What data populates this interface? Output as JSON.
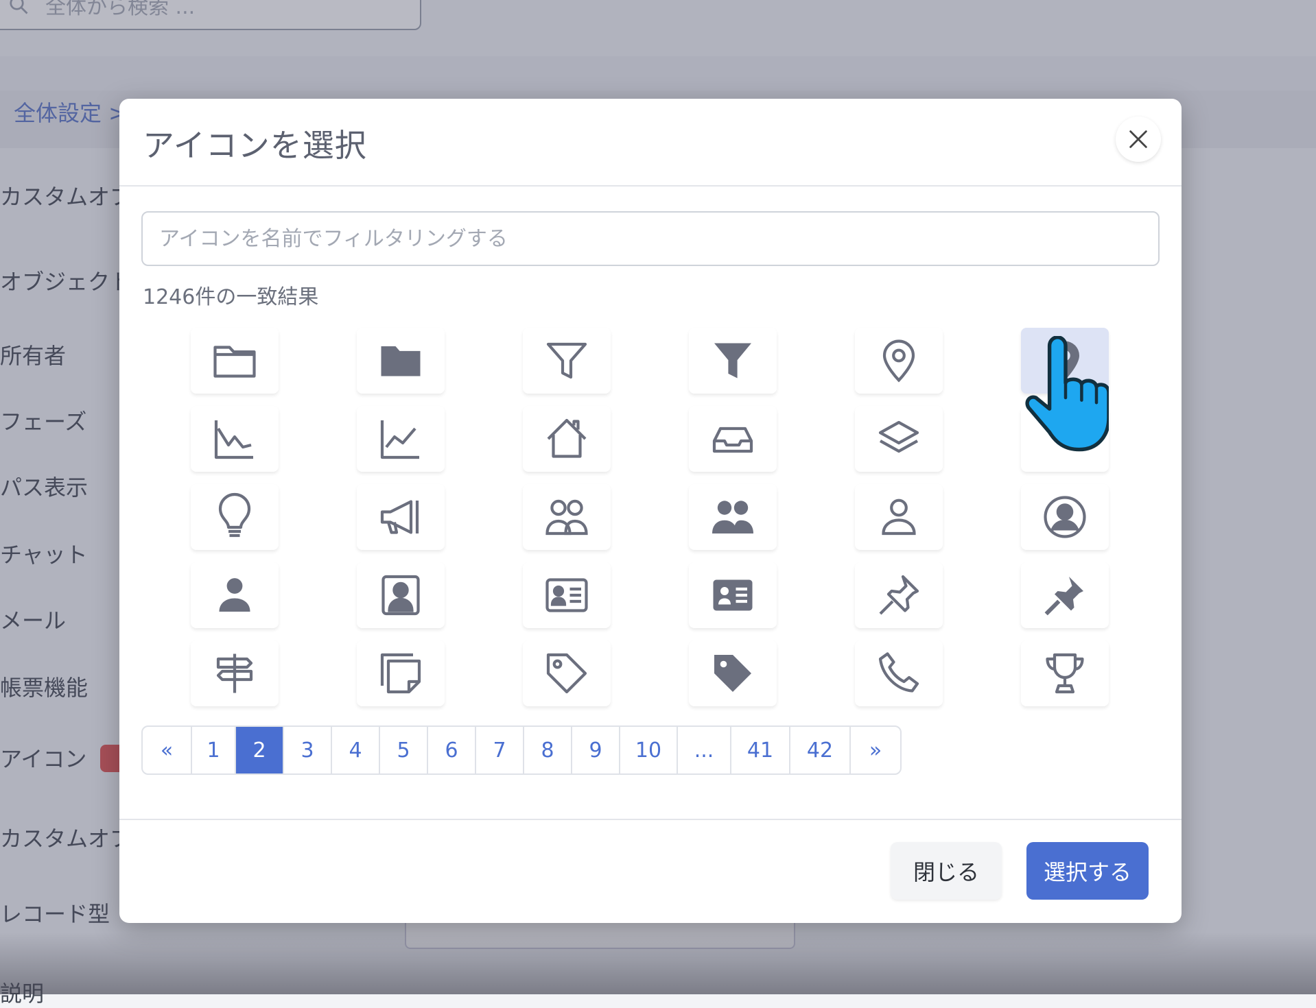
{
  "background": {
    "search_placeholder": "全体から検索 ...",
    "breadcrumb": "全体設定 >",
    "sidebar_items": [
      "カスタムオブ",
      "オブジェクト",
      "所有者",
      "フェーズ",
      "パス表示",
      "チャット",
      "メール",
      "帳票機能",
      "アイコン",
      "カスタムオブ",
      "レコード型",
      "説明"
    ]
  },
  "modal": {
    "title": "アイコンを選択",
    "filter_placeholder": "アイコンを名前でフィルタリングする",
    "match_count": "1246件の一致結果",
    "selected_icon": "location-pin-solid-icon",
    "icons": [
      "folder-outline-icon",
      "folder-solid-icon",
      "filter-outline-icon",
      "filter-solid-icon",
      "location-pin-outline-icon",
      "location-pin-solid-icon",
      "chart-area-down-icon",
      "chart-line-up-icon",
      "home-outline-icon",
      "inbox-tray-icon",
      "layers-icon",
      "blank-icon",
      "lightbulb-icon",
      "megaphone-icon",
      "users-outline-icon",
      "users-solid-icon",
      "user-outline-icon",
      "user-circle-icon",
      "user-solid-icon",
      "portrait-icon",
      "id-card-outline-icon",
      "id-card-solid-icon",
      "pushpin-outline-icon",
      "pushpin-solid-icon",
      "signpost-icon",
      "sticky-notes-icon",
      "tag-outline-icon",
      "tag-solid-icon",
      "phone-icon",
      "trophy-icon"
    ],
    "pagination": {
      "prev": "«",
      "next": "»",
      "pages": [
        "1",
        "2",
        "3",
        "4",
        "5",
        "6",
        "7",
        "8",
        "9",
        "10",
        "...",
        "41",
        "42"
      ],
      "current": "2"
    },
    "footer": {
      "close_label": "閉じる",
      "select_label": "選択する"
    }
  },
  "colors": {
    "icon": "#6b6f7e",
    "accent": "#4a6fd1",
    "selected_bg": "#dde3f5",
    "cursor": "#1ea7f0"
  }
}
